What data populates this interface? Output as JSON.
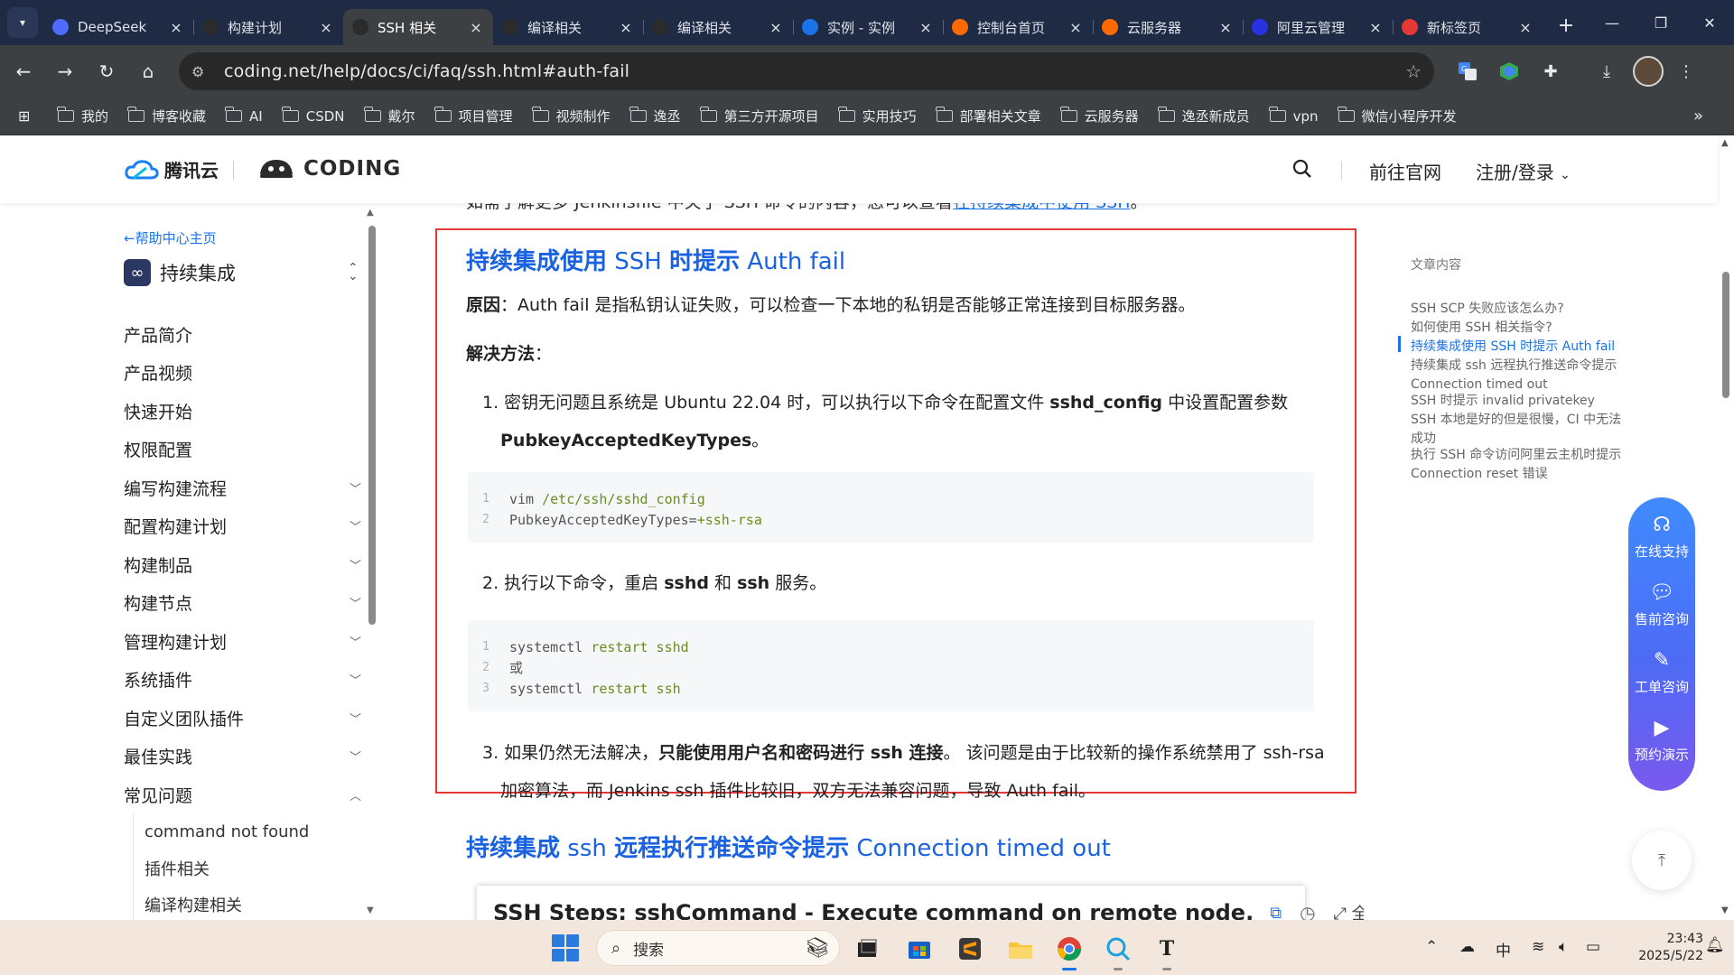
{
  "browser": {
    "tabs": [
      {
        "label": "DeepSeek",
        "icon": "deepseek-icon",
        "color": "#4d6bfe",
        "active": false
      },
      {
        "label": "构建计划",
        "icon": "coding-icon",
        "color": "#2b2b2b",
        "active": false
      },
      {
        "label": "SSH 相关",
        "icon": "coding-icon",
        "color": "#2b2b2b",
        "active": true
      },
      {
        "label": "编译相关",
        "icon": "coding-icon",
        "color": "#2b2b2b",
        "active": false
      },
      {
        "label": "编译相关",
        "icon": "coding-icon",
        "color": "#2b2b2b",
        "active": false
      },
      {
        "label": "实例 - 实例",
        "icon": "chart-icon",
        "color": "#1a73e8",
        "active": false
      },
      {
        "label": "控制台首页",
        "icon": "aliyun-icon",
        "color": "#ff6a00",
        "active": false
      },
      {
        "label": "云服务器",
        "icon": "aliyun-icon",
        "color": "#ff6a00",
        "active": false
      },
      {
        "label": "阿里云管理",
        "icon": "baidu-icon",
        "color": "#2932e1",
        "active": false
      },
      {
        "label": "新标签页",
        "icon": "infinity-icon",
        "color": "#e53935",
        "active": false
      }
    ],
    "url": "coding.net/help/docs/ci/faq/ssh.html#auth-fail",
    "bookmarks": [
      "我的",
      "博客收藏",
      "AI",
      "CSDN",
      "戴尔",
      "项目管理",
      "视频制作",
      "逸丞",
      "第三方开源项目",
      "实用技巧",
      "部署相关文章",
      "云服务器",
      "逸丞新成员",
      "vpn",
      "微信小程序开发"
    ]
  },
  "header": {
    "tencent_logo": "腾讯云",
    "coding_logo": "CODING",
    "nav_official": "前往官网",
    "nav_login": "注册/登录"
  },
  "sidebar": {
    "back_link": "←帮助中心主页",
    "product": "持续集成",
    "items": [
      {
        "label": "产品简介",
        "expandable": false
      },
      {
        "label": "产品视频",
        "expandable": false
      },
      {
        "label": "快速开始",
        "expandable": false
      },
      {
        "label": "权限配置",
        "expandable": false
      },
      {
        "label": "编写构建流程",
        "expandable": true
      },
      {
        "label": "配置构建计划",
        "expandable": true
      },
      {
        "label": "构建制品",
        "expandable": true
      },
      {
        "label": "构建节点",
        "expandable": true
      },
      {
        "label": "管理构建计划",
        "expandable": true
      },
      {
        "label": "系统插件",
        "expandable": true
      },
      {
        "label": "自定义团队插件",
        "expandable": true
      },
      {
        "label": "最佳实践",
        "expandable": true
      },
      {
        "label": "常见问题",
        "expandable": true,
        "expanded": true
      }
    ],
    "sub_items": [
      "command not found",
      "插件相关",
      "编译构建相关"
    ]
  },
  "article": {
    "cut_line_prefix": "如需了解更多 Jenkinsfile 中关于 SSH 命令的内容，您可以查看",
    "cut_line_link": "在持续集成中使用 SSH",
    "cut_line_suffix": "。",
    "section1": {
      "title_bold_1": "持续集成使用",
      "title_light_1": " SSH ",
      "title_bold_2": "时提示",
      "title_light_2": " Auth fail",
      "reason_label": "原因",
      "reason_text": "：Auth fail 是指私钥认证失败，可以检查一下本地的私钥是否能够正常连接到目标服务器。",
      "solution_label": "解决方法",
      "solution_colon": "：",
      "step1_prefix": "1. 密钥无问题且系统是 Ubuntu 22.04 时，可以执行以下命令在配置文件 ",
      "step1_bold": "sshd_config",
      "step1_suffix": " 中设置配置参数",
      "step1_cont_bold": "PubkeyAcceptedKeyTypes",
      "step1_cont_suffix": "。",
      "code1": [
        {
          "n": "1",
          "plain": "vim ",
          "kw": "/etc/ssh/sshd_config"
        },
        {
          "n": "2",
          "plain": "PubkeyAcceptedKeyTypes=",
          "kw": "+ssh-rsa"
        }
      ],
      "step2_prefix": "2. 执行以下命令，重启 ",
      "step2_b1": "sshd",
      "step2_mid": " 和 ",
      "step2_b2": "ssh",
      "step2_suffix": " 服务。",
      "code2": [
        {
          "n": "1",
          "plain": "systemctl ",
          "kw": "restart sshd"
        },
        {
          "n": "2",
          "plain": "或",
          "kw": ""
        },
        {
          "n": "3",
          "plain": "systemctl ",
          "kw": "restart ssh"
        }
      ],
      "step3_prefix": "3. 如果仍然无法解决，",
      "step3_bold": "只能使用用户名和密码进行 ssh 连接",
      "step3_suffix": "。 该问题是由于比较新的操作系统禁用了 ssh-rsa",
      "step3_cont": "加密算法，而 Jenkins ssh 插件比较旧，双方无法兼容问题，导致 Auth fail。"
    },
    "section2": {
      "title_bold_1": "持续集成",
      "title_light_1": " ssh ",
      "title_bold_2": "远程执行推送命令提示",
      "title_light_2": " Connection timed out"
    },
    "embed_title": "SSH Steps: sshCommand - Execute command on remote node.",
    "embed_fullscreen": "全屏"
  },
  "toc": {
    "title": "文章内容",
    "items": [
      "SSH SCP 失败应该怎么办?",
      "如何使用 SSH 相关指令?",
      "持续集成使用 SSH 时提示 Auth fail",
      "持续集成 ssh 远程执行推送命令提示 Connection timed out",
      "SSH 时提示 invalid privatekey",
      "SSH 本地是好的但是很慢，CI 中无法成功",
      "执行 SSH 命令访问阿里云主机时提示 Connection reset 错误"
    ],
    "active_index": 2
  },
  "support": {
    "items": [
      "在线支持",
      "售前咨询",
      "工单咨询",
      "预约演示"
    ]
  },
  "taskbar": {
    "search_placeholder": "搜索",
    "ime": "中",
    "time": "23:43",
    "date": "2025/5/22"
  },
  "colors": {
    "accent": "#1a62e0",
    "highlight_border": "#e53935",
    "support_gradient_top": "#3f8bff",
    "support_gradient_bottom": "#7a59ee"
  }
}
